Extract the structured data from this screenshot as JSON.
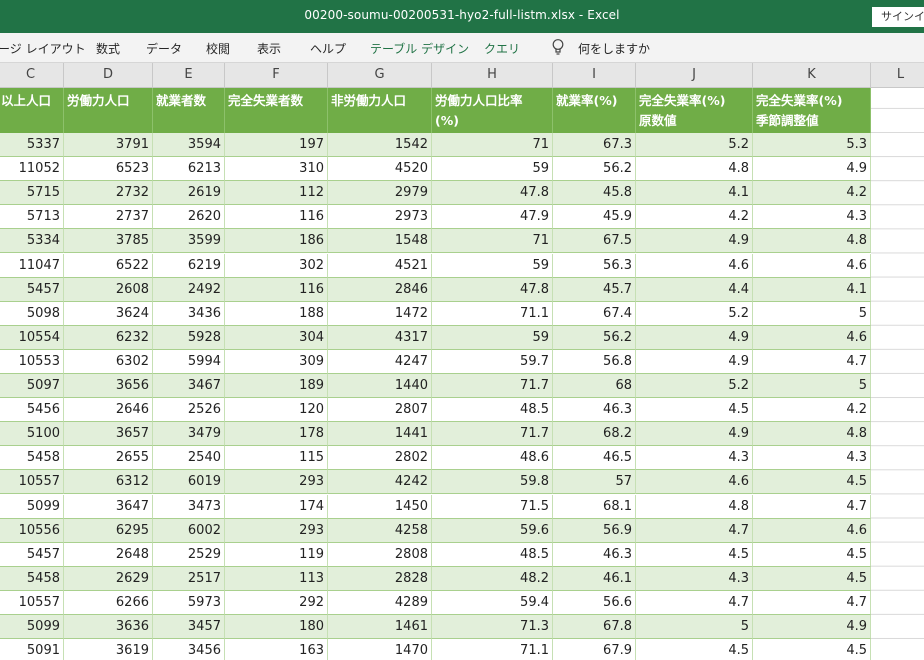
{
  "window": {
    "title": "00200-soumu-00200531-hyo2-full-listm.xlsx  -  Excel",
    "signin_label": "サインイン"
  },
  "ribbon": {
    "tabs": [
      "ージ レイアウト",
      "数式",
      "データ",
      "校閲",
      "表示",
      "ヘルプ",
      "テーブル デザイン",
      "クエリ"
    ],
    "tell_me": "何をしますか",
    "tell_me_icon": "lightbulb-icon"
  },
  "columns": [
    "C",
    "D",
    "E",
    "F",
    "G",
    "H",
    "I",
    "J",
    "K",
    "L"
  ],
  "table": {
    "headers": [
      [
        "以上人口",
        ""
      ],
      [
        "労働力人口",
        ""
      ],
      [
        "就業者数",
        ""
      ],
      [
        "完全失業者数",
        ""
      ],
      [
        "非労働力人口",
        ""
      ],
      [
        "労働力人口比率",
        "(%)"
      ],
      [
        "就業率(%)",
        ""
      ],
      [
        "完全失業率(%)",
        "原数値"
      ],
      [
        "完全失業率(%)",
        "季節調整値"
      ]
    ],
    "rows": [
      [
        "5337",
        "3791",
        "3594",
        "197",
        "1542",
        "71",
        "67.3",
        "5.2",
        "5.3"
      ],
      [
        "11052",
        "6523",
        "6213",
        "310",
        "4520",
        "59",
        "56.2",
        "4.8",
        "4.9"
      ],
      [
        "5715",
        "2732",
        "2619",
        "112",
        "2979",
        "47.8",
        "45.8",
        "4.1",
        "4.2"
      ],
      [
        "5713",
        "2737",
        "2620",
        "116",
        "2973",
        "47.9",
        "45.9",
        "4.2",
        "4.3"
      ],
      [
        "5334",
        "3785",
        "3599",
        "186",
        "1548",
        "71",
        "67.5",
        "4.9",
        "4.8"
      ],
      [
        "11047",
        "6522",
        "6219",
        "302",
        "4521",
        "59",
        "56.3",
        "4.6",
        "4.6"
      ],
      [
        "5457",
        "2608",
        "2492",
        "116",
        "2846",
        "47.8",
        "45.7",
        "4.4",
        "4.1"
      ],
      [
        "5098",
        "3624",
        "3436",
        "188",
        "1472",
        "71.1",
        "67.4",
        "5.2",
        "5"
      ],
      [
        "10554",
        "6232",
        "5928",
        "304",
        "4317",
        "59",
        "56.2",
        "4.9",
        "4.6"
      ],
      [
        "10553",
        "6302",
        "5994",
        "309",
        "4247",
        "59.7",
        "56.8",
        "4.9",
        "4.7"
      ],
      [
        "5097",
        "3656",
        "3467",
        "189",
        "1440",
        "71.7",
        "68",
        "5.2",
        "5"
      ],
      [
        "5456",
        "2646",
        "2526",
        "120",
        "2807",
        "48.5",
        "46.3",
        "4.5",
        "4.2"
      ],
      [
        "5100",
        "3657",
        "3479",
        "178",
        "1441",
        "71.7",
        "68.2",
        "4.9",
        "4.8"
      ],
      [
        "5458",
        "2655",
        "2540",
        "115",
        "2802",
        "48.6",
        "46.5",
        "4.3",
        "4.3"
      ],
      [
        "10557",
        "6312",
        "6019",
        "293",
        "4242",
        "59.8",
        "57",
        "4.6",
        "4.5"
      ],
      [
        "5099",
        "3647",
        "3473",
        "174",
        "1450",
        "71.5",
        "68.1",
        "4.8",
        "4.7"
      ],
      [
        "10556",
        "6295",
        "6002",
        "293",
        "4258",
        "59.6",
        "56.9",
        "4.7",
        "4.6"
      ],
      [
        "5457",
        "2648",
        "2529",
        "119",
        "2808",
        "48.5",
        "46.3",
        "4.5",
        "4.5"
      ],
      [
        "5458",
        "2629",
        "2517",
        "113",
        "2828",
        "48.2",
        "46.1",
        "4.3",
        "4.5"
      ],
      [
        "10557",
        "6266",
        "5973",
        "292",
        "4289",
        "59.4",
        "56.6",
        "4.7",
        "4.7"
      ],
      [
        "5099",
        "3636",
        "3457",
        "180",
        "1461",
        "71.3",
        "67.8",
        "5",
        "4.9"
      ],
      [
        "5091",
        "3619",
        "3456",
        "163",
        "1470",
        "71.1",
        "67.9",
        "4.5",
        "4.5"
      ]
    ]
  },
  "colors": {
    "title_bar": "#217346",
    "table_header": "#70ad47",
    "band_row": "#e2efda"
  }
}
